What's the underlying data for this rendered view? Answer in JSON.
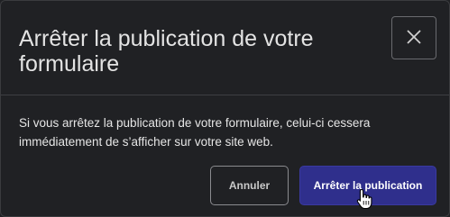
{
  "dialog": {
    "title": "Arrêter la publication de votre formulaire",
    "close_icon": "close-icon",
    "message": "Si vous arrêtez la publication de votre formulaire, celui-ci cessera immédiatement de s’afficher sur votre site web.",
    "buttons": {
      "cancel_label": "Annuler",
      "confirm_label": "Arrêter la publication"
    }
  },
  "colors": {
    "background": "#202124",
    "primary_button": "#2f2f8c",
    "text": "#e3e3e3"
  },
  "cursor_icon": "hand-pointer-icon"
}
